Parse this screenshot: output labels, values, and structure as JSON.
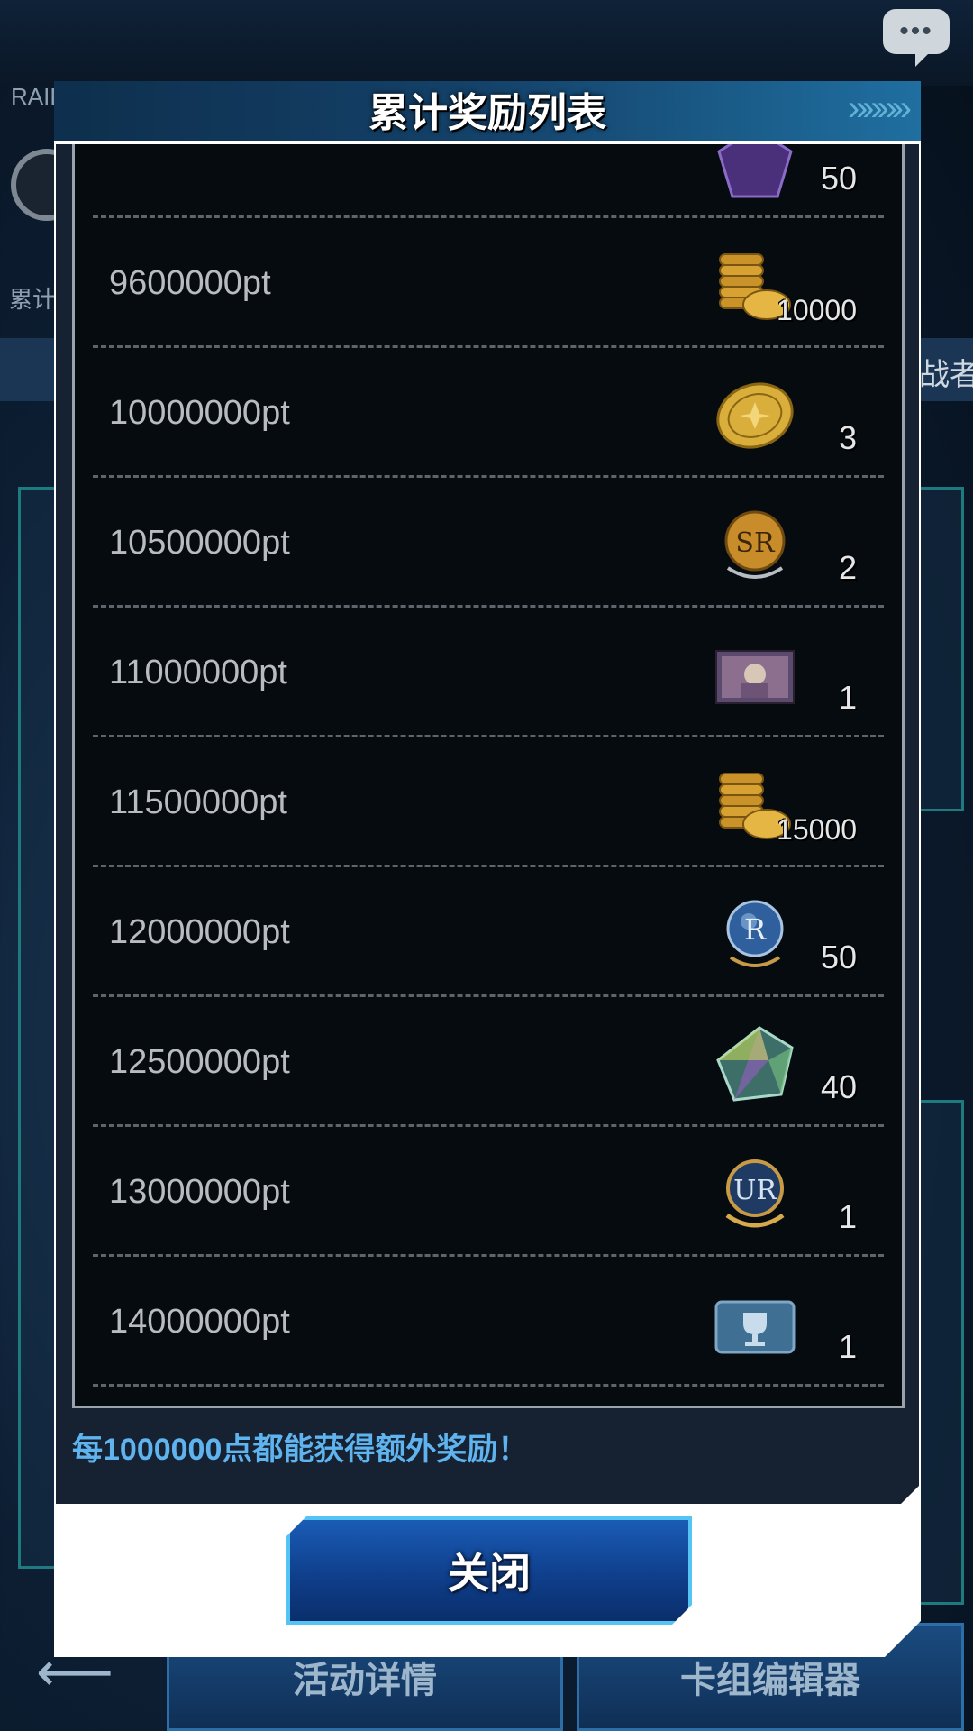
{
  "background": {
    "raid_label": "RAID D",
    "cumulative_label": "累计",
    "challenger_label": "战者",
    "event_details_button": "活动详情",
    "deck_editor_button": "卡组编辑器",
    "chat_icon": "chat-bubble-icon"
  },
  "dialog": {
    "title": "累计奖励列表",
    "bonus_note": "每1000000点都能获得额外奖励！",
    "close_button": "关闭",
    "partial_top_count": "50",
    "rows": [
      {
        "points": "9600000pt",
        "icon": "gold-stack-icon",
        "count": "10000"
      },
      {
        "points": "10000000pt",
        "icon": "gold-coin-icon",
        "count": "3"
      },
      {
        "points": "10500000pt",
        "icon": "sr-ticket-icon",
        "count": "2"
      },
      {
        "points": "11000000pt",
        "icon": "card-art-icon",
        "count": "1"
      },
      {
        "points": "11500000pt",
        "icon": "gold-stack-icon",
        "count": "15000"
      },
      {
        "points": "12000000pt",
        "icon": "r-orb-icon",
        "count": "50"
      },
      {
        "points": "12500000pt",
        "icon": "gem-icon",
        "count": "40"
      },
      {
        "points": "13000000pt",
        "icon": "ur-ticket-icon",
        "count": "1"
      },
      {
        "points": "14000000pt",
        "icon": "trophy-ticket-icon",
        "count": "1"
      }
    ]
  }
}
